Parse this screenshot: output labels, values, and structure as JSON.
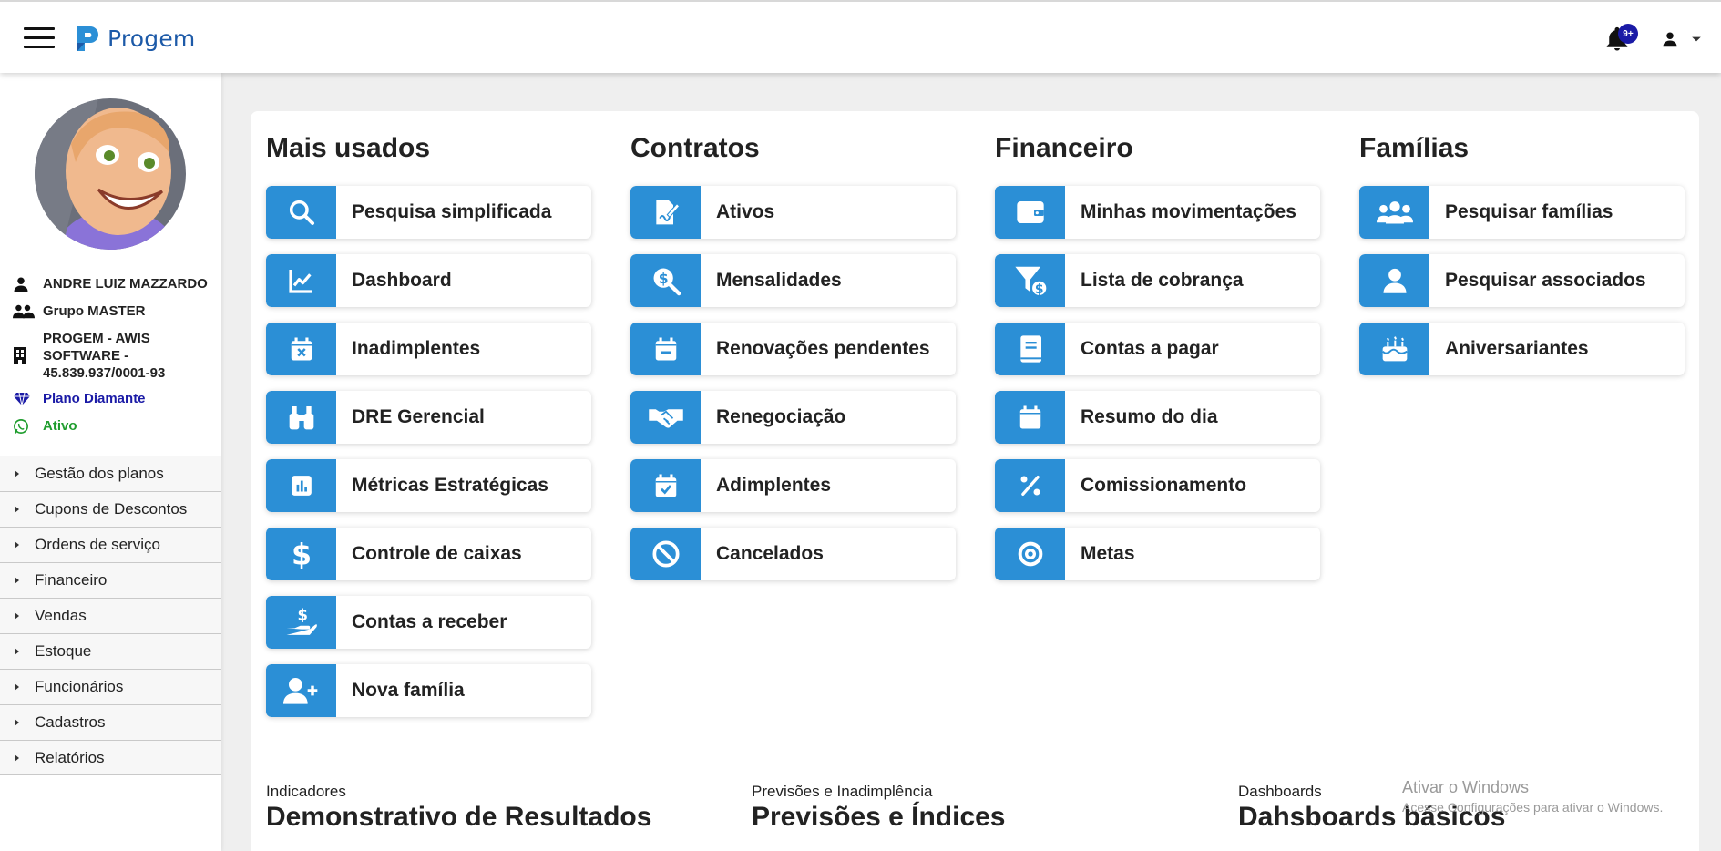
{
  "header": {
    "app_name": "Progem",
    "notification_badge": "9+",
    "brand_color": "#1d5aa8"
  },
  "sidebar": {
    "user_name": "ANDRE LUIZ MAZZARDO",
    "group": "Grupo MASTER",
    "company": "PROGEM - AWIS SOFTWARE - 45.839.937/0001-93",
    "plan": "Plano Diamante",
    "status": "Ativo",
    "menu": [
      {
        "label": "Gestão dos planos"
      },
      {
        "label": "Cupons de Descontos"
      },
      {
        "label": "Ordens de serviço"
      },
      {
        "label": "Financeiro"
      },
      {
        "label": "Vendas"
      },
      {
        "label": "Estoque"
      },
      {
        "label": "Funcionários"
      },
      {
        "label": "Cadastros"
      },
      {
        "label": "Relatórios"
      }
    ]
  },
  "columns": [
    {
      "title": "Mais usados",
      "items": [
        {
          "label": "Pesquisa simplificada",
          "icon": "search-icon"
        },
        {
          "label": "Dashboard",
          "icon": "line-chart-icon"
        },
        {
          "label": "Inadimplentes",
          "icon": "calendar-x-icon"
        },
        {
          "label": "DRE Gerencial",
          "icon": "binoculars-icon"
        },
        {
          "label": "Métricas Estratégicas",
          "icon": "bar-chart-icon"
        },
        {
          "label": "Controle de caixas",
          "icon": "dollar-icon"
        },
        {
          "label": "Contas a receber",
          "icon": "hand-money-icon"
        },
        {
          "label": "Nova família",
          "icon": "user-plus-icon"
        }
      ]
    },
    {
      "title": "Contratos",
      "items": [
        {
          "label": "Ativos",
          "icon": "contract-sign-icon"
        },
        {
          "label": "Mensalidades",
          "icon": "search-dollar-icon"
        },
        {
          "label": "Renovações pendentes",
          "icon": "calendar-minus-icon"
        },
        {
          "label": "Renegociação",
          "icon": "handshake-icon"
        },
        {
          "label": "Adimplentes",
          "icon": "calendar-check-icon"
        },
        {
          "label": "Cancelados",
          "icon": "ban-icon"
        }
      ]
    },
    {
      "title": "Financeiro",
      "items": [
        {
          "label": "Minhas movimentações",
          "icon": "wallet-icon"
        },
        {
          "label": "Lista de cobrança",
          "icon": "filter-dollar-icon"
        },
        {
          "label": "Contas a pagar",
          "icon": "book-icon"
        },
        {
          "label": "Resumo do dia",
          "icon": "calendar-icon"
        },
        {
          "label": "Comissionamento",
          "icon": "percent-icon"
        },
        {
          "label": "Metas",
          "icon": "target-icon"
        }
      ]
    },
    {
      "title": "Famílias",
      "items": [
        {
          "label": "Pesquisar famílias",
          "icon": "users-icon"
        },
        {
          "label": "Pesquisar associados",
          "icon": "user-icon"
        },
        {
          "label": "Aniversariantes",
          "icon": "cake-icon"
        }
      ]
    }
  ],
  "sections": [
    {
      "subtitle": "Indicadores",
      "title": "Demonstrativo de Resultados"
    },
    {
      "subtitle": "Previsões e Inadimplência",
      "title": "Previsões e Índices"
    },
    {
      "subtitle": "Dashboards",
      "title": "Dahsboards básicos"
    }
  ],
  "watermark": {
    "line1": "Ativar o Windows",
    "line2": "Acesse Configurações para ativar o Windows."
  },
  "colors": {
    "tile_icon_bg": "#2b8fd6",
    "plan_color": "#1a1aa6",
    "status_color": "#1f9d2e"
  }
}
